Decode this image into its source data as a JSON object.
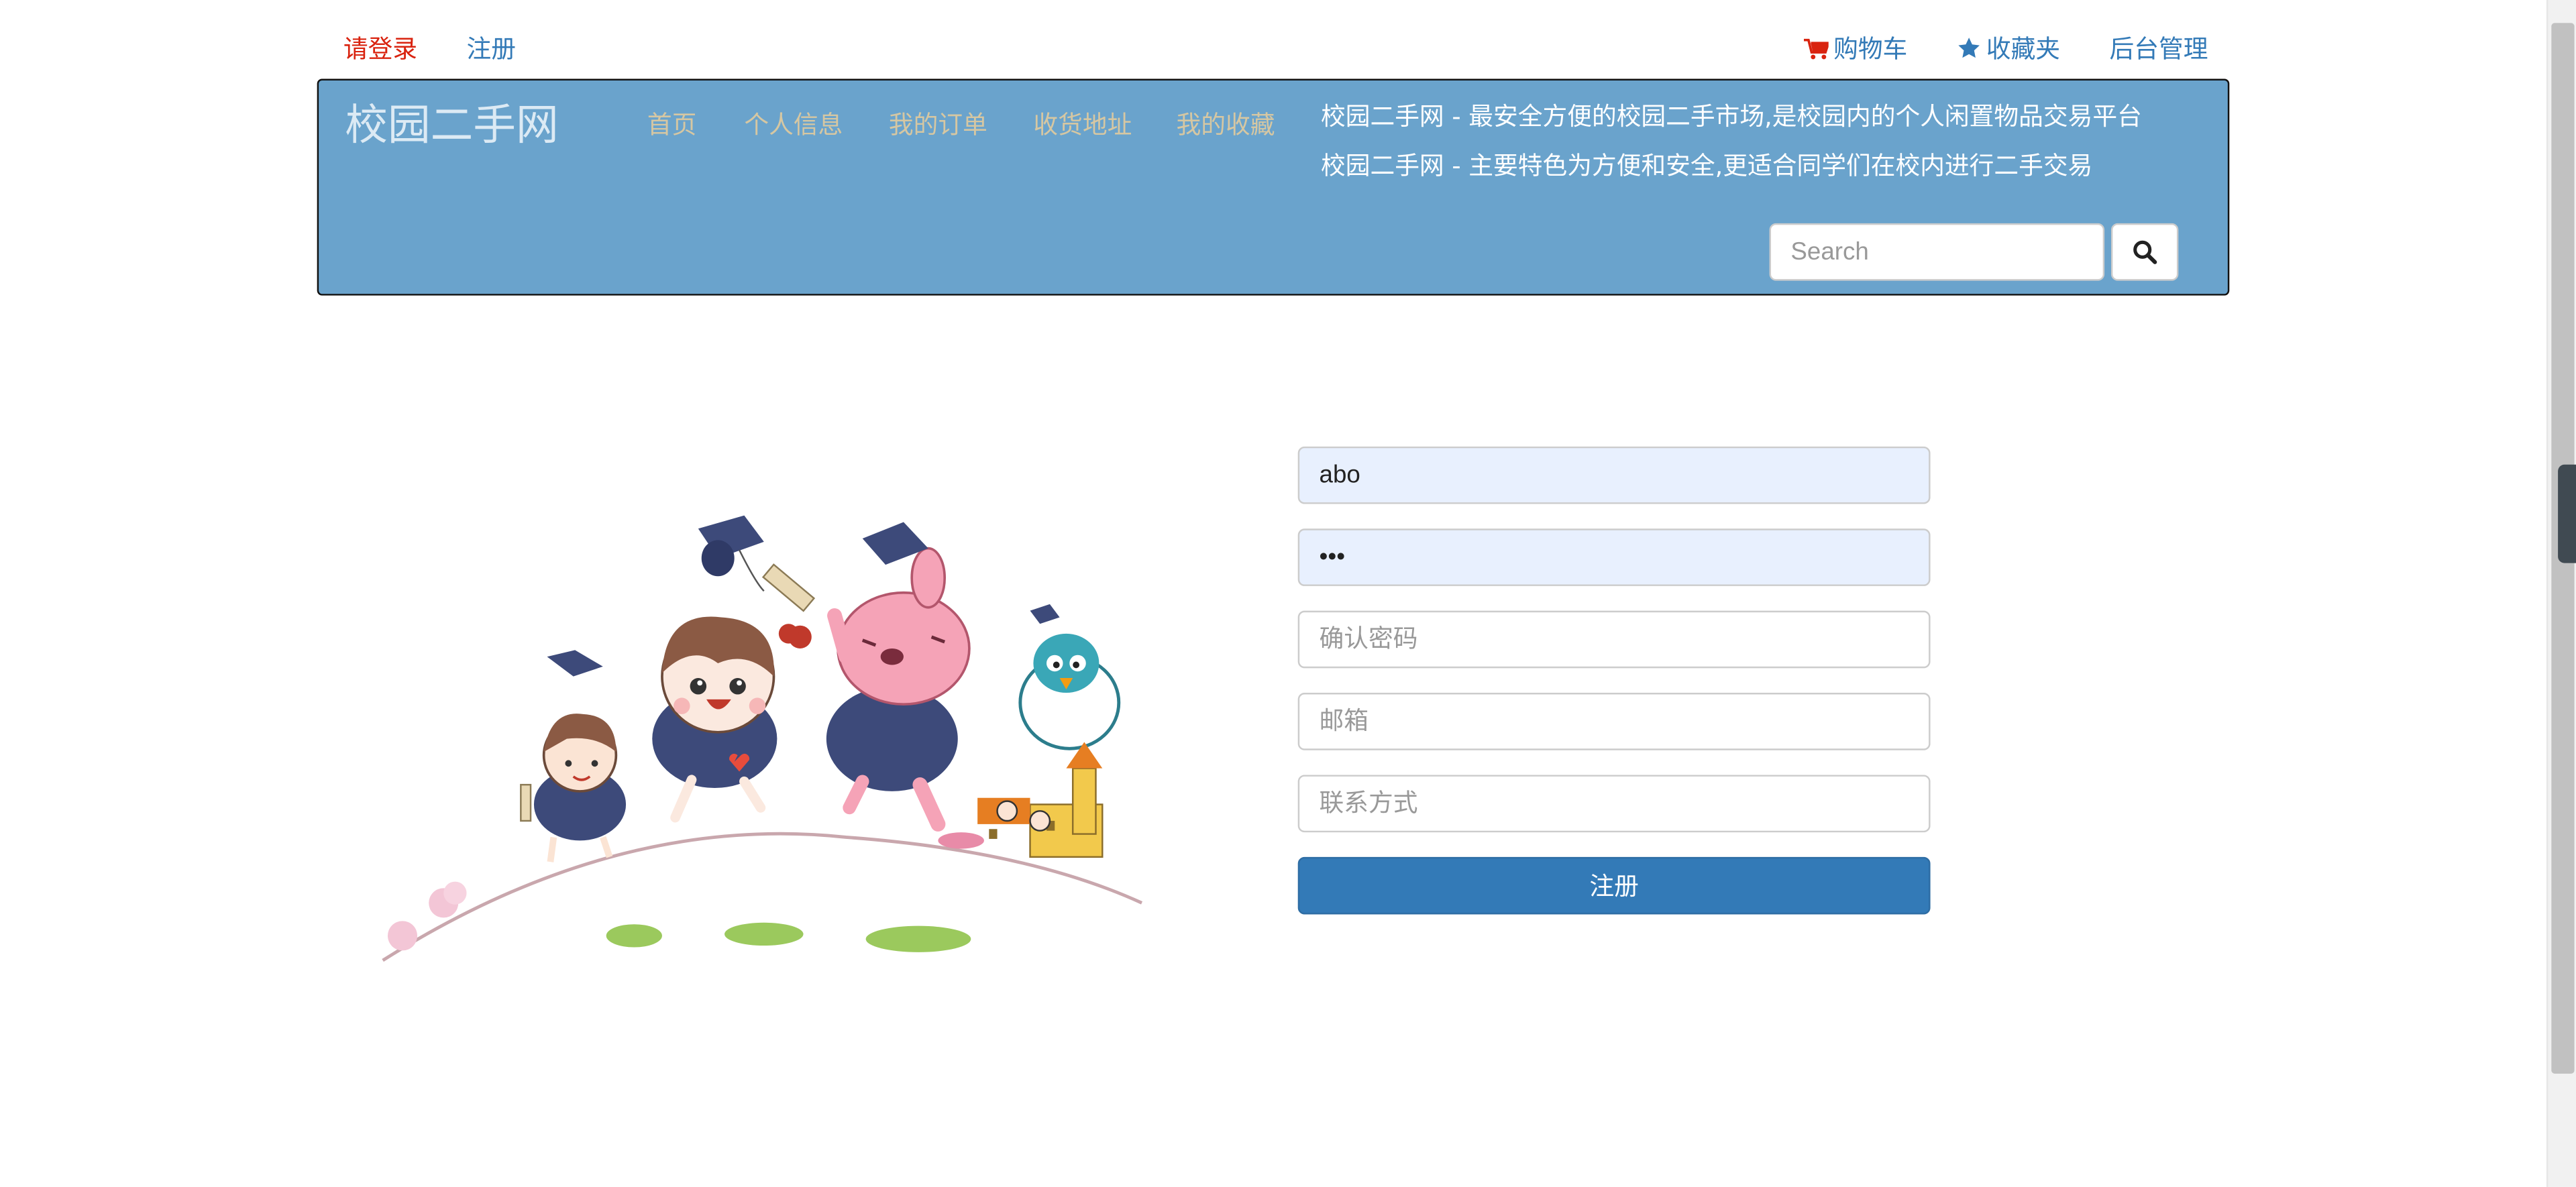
{
  "top_links": {
    "login": "请登录",
    "register": "注册",
    "cart": "购物车",
    "favorites": "收藏夹",
    "admin": "后台管理"
  },
  "navbar": {
    "brand": "校园二手网",
    "items": [
      "首页",
      "个人信息",
      "我的订单",
      "收货地址",
      "我的收藏"
    ],
    "slogans": [
      "校园二手网 - 最安全方便的校园二手市场,是校园内的个人闲置物品交易平台",
      "校园二手网 - 主要特色为方便和安全,更适合同学们在校内进行二手交易"
    ],
    "search_placeholder": "Search"
  },
  "form": {
    "username_value": "abo",
    "password_value": "abc",
    "confirm_placeholder": "确认密码",
    "email_placeholder": "邮箱",
    "contact_placeholder": "联系方式",
    "submit_label": "注册"
  },
  "icons": {
    "cart": "shopping-cart-icon",
    "favorites": "star-icon",
    "search": "magnifier-icon"
  },
  "colors": {
    "navbar_bg": "#6aa3cc",
    "primary": "#337ab7",
    "link_red": "#d9230f"
  }
}
